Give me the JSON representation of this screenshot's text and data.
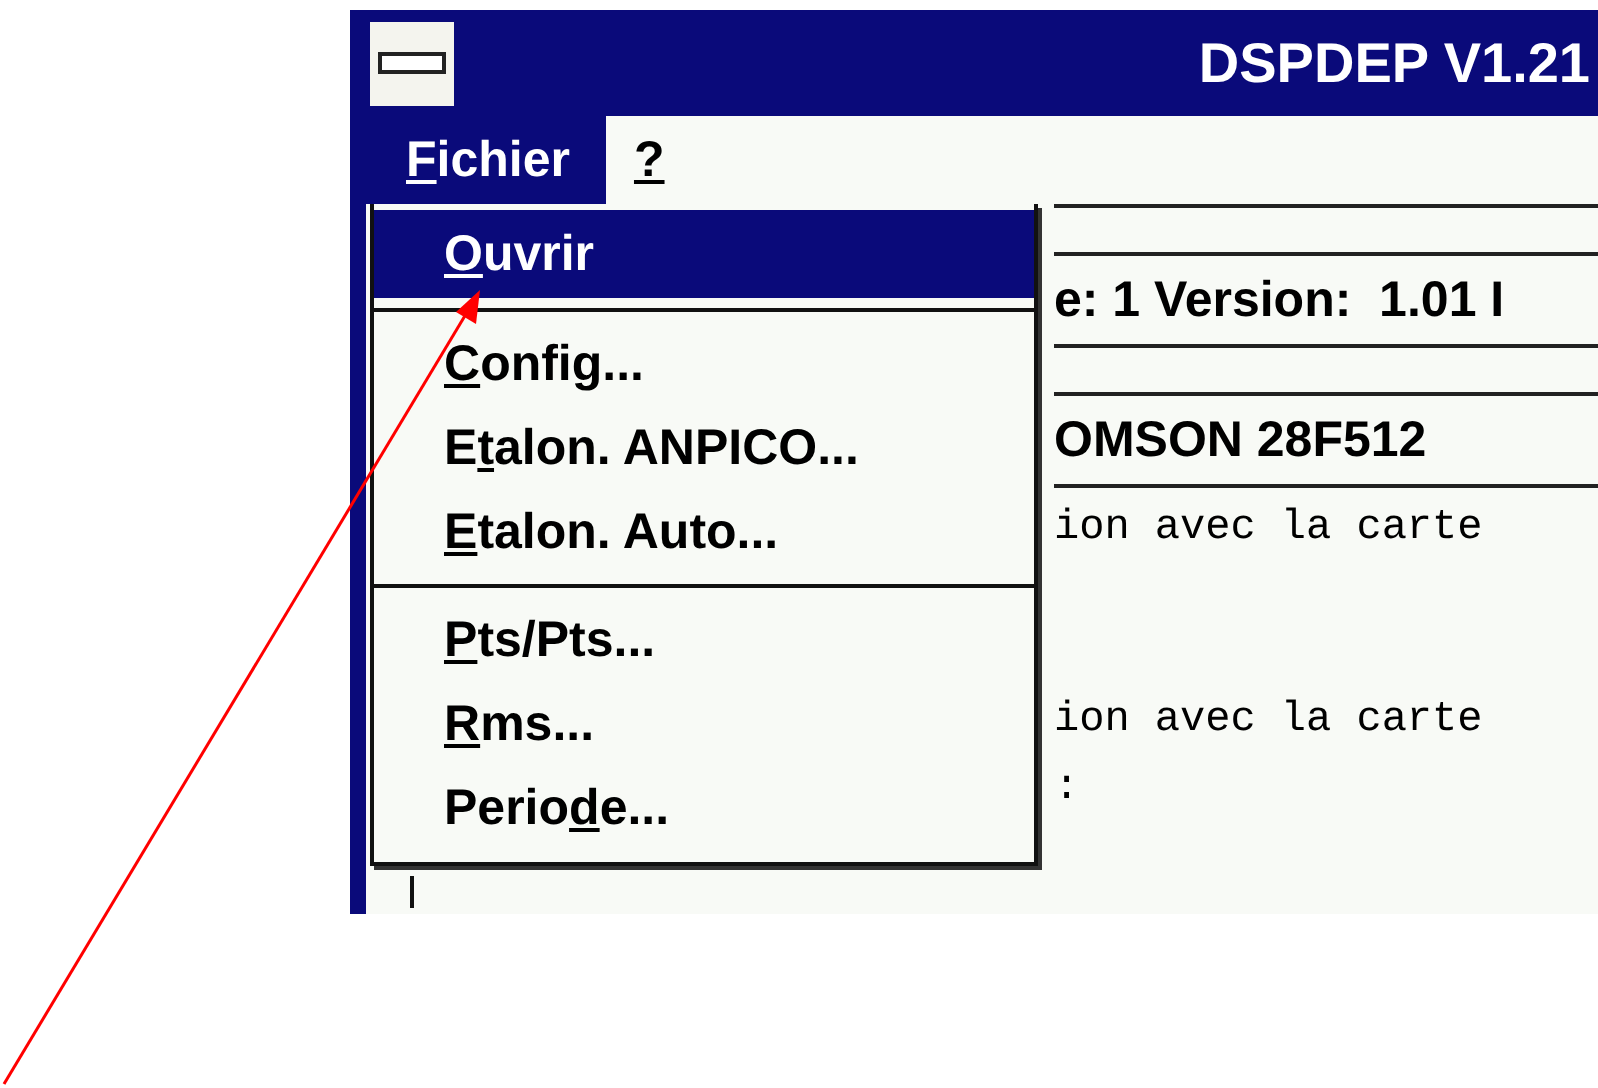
{
  "window": {
    "title": "DSPDEP V1.21"
  },
  "menu_bar": [
    {
      "key": "F",
      "after": "ichier",
      "selected": true
    },
    {
      "key": "?",
      "selected": false
    }
  ],
  "dropdown": [
    {
      "kind": "item",
      "key": "O",
      "after": "uvrir",
      "selected": true
    },
    {
      "kind": "separator"
    },
    {
      "kind": "item",
      "key": "C",
      "after": "onfig...",
      "selected": false
    },
    {
      "kind": "item",
      "before": "E",
      "key": "t",
      "after": "alon. ANPICO...",
      "selected": false
    },
    {
      "kind": "item",
      "key": "E",
      "after": "talon. Auto...",
      "selected": false
    },
    {
      "kind": "separator"
    },
    {
      "kind": "item",
      "key": "P",
      "after": "ts/Pts...",
      "selected": false
    },
    {
      "kind": "item",
      "key": "R",
      "after": "ms...",
      "selected": false
    },
    {
      "kind": "item",
      "before": "Perio",
      "key": "d",
      "after": "e...",
      "selected": false
    }
  ],
  "content": [
    {
      "kind": "field",
      "text": "e: 1 Version:  1.01 I"
    },
    {
      "kind": "field",
      "text": "OMSON 28F512"
    },
    {
      "kind": "mono",
      "text": "ion avec la carte"
    },
    {
      "kind": "mono",
      "text": "ion avec la carte"
    },
    {
      "kind": "mono",
      "text": ":"
    }
  ]
}
